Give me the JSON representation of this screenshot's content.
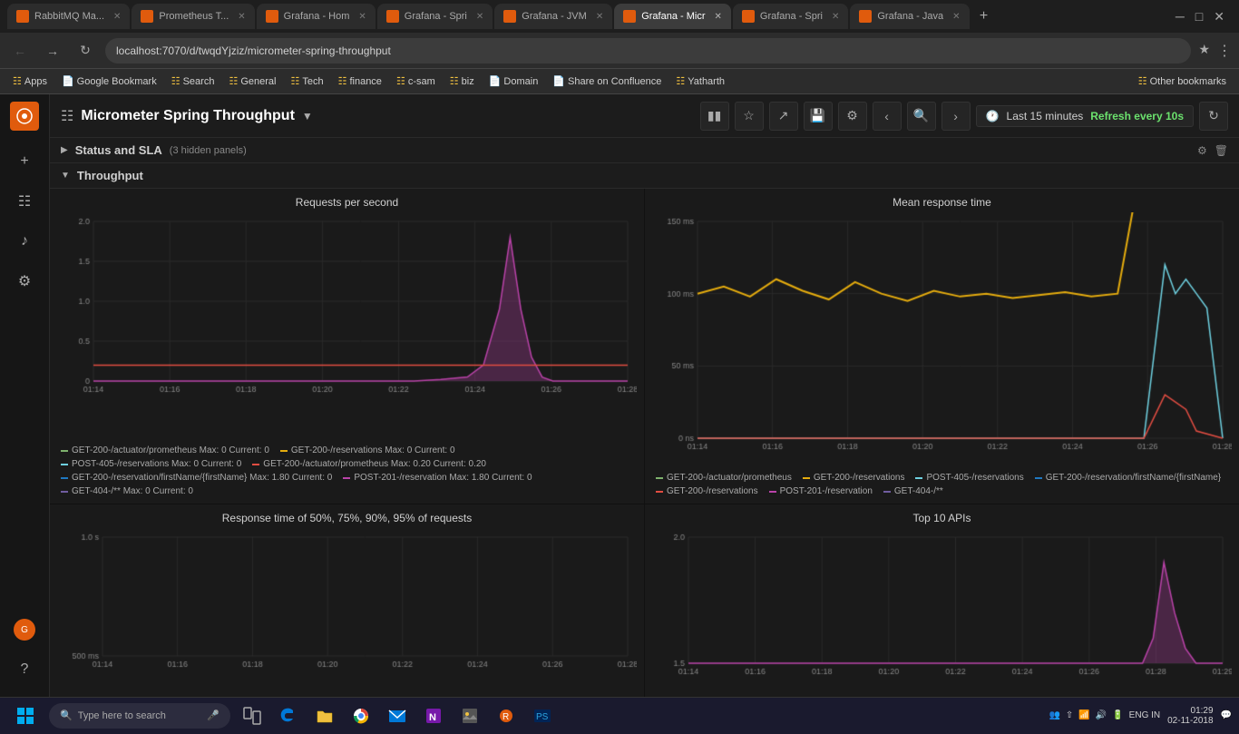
{
  "browser": {
    "tabs": [
      {
        "id": "t1",
        "title": "RabbitMQ Ma...",
        "favicon_color": "#e05b0d",
        "active": false
      },
      {
        "id": "t2",
        "title": "Prometheus T...",
        "favicon_color": "#e05b0d",
        "active": false
      },
      {
        "id": "t3",
        "title": "Grafana - Hom",
        "favicon_color": "#e05b0d",
        "active": false
      },
      {
        "id": "t4",
        "title": "Grafana - Spri",
        "favicon_color": "#e05b0d",
        "active": false
      },
      {
        "id": "t5",
        "title": "Grafana - JVM",
        "favicon_color": "#e05b0d",
        "active": false
      },
      {
        "id": "t6",
        "title": "Grafana - Micr",
        "favicon_color": "#e05b0d",
        "active": true
      },
      {
        "id": "t7",
        "title": "Grafana - Spri",
        "favicon_color": "#e05b0d",
        "active": false
      },
      {
        "id": "t8",
        "title": "Grafana - Java",
        "favicon_color": "#e05b0d",
        "active": false
      }
    ],
    "address": "localhost:7070/d/twqdYjziz/micrometer-spring-throughput",
    "bookmarks": [
      {
        "label": "Apps",
        "type": "folder"
      },
      {
        "label": "Google Bookmark",
        "type": "page"
      },
      {
        "label": "Search",
        "type": "folder"
      },
      {
        "label": "General",
        "type": "folder"
      },
      {
        "label": "Tech",
        "type": "folder"
      },
      {
        "label": "finance",
        "type": "folder"
      },
      {
        "label": "c-sam",
        "type": "folder"
      },
      {
        "label": "biz",
        "type": "folder"
      },
      {
        "label": "Domain",
        "type": "page"
      },
      {
        "label": "Share on Confluence",
        "type": "page"
      },
      {
        "label": "Yatharth",
        "type": "folder"
      },
      {
        "label": "Other bookmarks",
        "type": "folder"
      }
    ]
  },
  "grafana": {
    "dashboard_title": "Micrometer Spring Throughput",
    "time_range": "Last 15 minutes",
    "refresh": "Refresh every 10s",
    "sections": {
      "status_sla": {
        "title": "Status and SLA",
        "badge": "(3 hidden panels)"
      },
      "throughput": {
        "title": "Throughput"
      }
    },
    "charts": {
      "requests_per_second": {
        "title": "Requests per second",
        "y_labels": [
          "2.0",
          "1.5",
          "1.0",
          "0.5",
          "0"
        ],
        "x_labels": [
          "01:14",
          "01:16",
          "01:18",
          "01:20",
          "01:22",
          "01:24",
          "01:26",
          "01:28"
        ],
        "legend": [
          {
            "label": "GET-200-/actuator/prometheus  Max: 0  Current: 0",
            "color": "#7eb26d"
          },
          {
            "label": "GET-200-/reservations  Max: 0  Current: 0",
            "color": "#e5ac0e"
          },
          {
            "label": "POST-405-/reservations  Max: 0  Current: 0",
            "color": "#6ed0e0"
          },
          {
            "label": "GET-200-/actuator/prometheus  Max: 0.20  Current: 0.20",
            "color": "#e24d42"
          },
          {
            "label": "GET-200-/reservation/firstName/{firstName}  Max: 1.80  Current: 0",
            "color": "#1f78c1"
          },
          {
            "label": "POST-201-/reservation  Max: 1.80  Current: 0",
            "color": "#ba43a9"
          },
          {
            "label": "GET-404-/**  Max: 0  Current: 0",
            "color": "#705da0"
          }
        ]
      },
      "mean_response_time": {
        "title": "Mean response time",
        "y_labels": [
          "150 ms",
          "100 ms",
          "50 ms",
          "0 ns"
        ],
        "x_labels": [
          "01:14",
          "01:16",
          "01:18",
          "01:20",
          "01:22",
          "01:24",
          "01:26",
          "01:28"
        ],
        "legend": [
          {
            "label": "GET-200-/actuator/prometheus",
            "color": "#7eb26d"
          },
          {
            "label": "GET-200-/reservations",
            "color": "#e5ac0e"
          },
          {
            "label": "POST-405-/reservations",
            "color": "#6ed0e0"
          },
          {
            "label": "GET-200-/reservation/firstName/{firstName}",
            "color": "#1f78c1"
          },
          {
            "label": "GET-200-/reservations",
            "color": "#e24d42"
          },
          {
            "label": "POST-201-/reservation",
            "color": "#ba43a9"
          },
          {
            "label": "GET-404-/**",
            "color": "#705da0"
          }
        ]
      },
      "response_percentiles": {
        "title": "Response time of 50%, 75%, 90%, 95% of requests",
        "y_labels": [
          "1.0 s",
          "500 ms"
        ]
      },
      "top10_apis": {
        "title": "Top 10 APIs",
        "y_labels": [
          "2.0",
          "1.5"
        ]
      }
    }
  },
  "taskbar": {
    "search_placeholder": "Type here to search",
    "time": "01:29",
    "date": "02-11-2018",
    "language": "ENG IN"
  }
}
